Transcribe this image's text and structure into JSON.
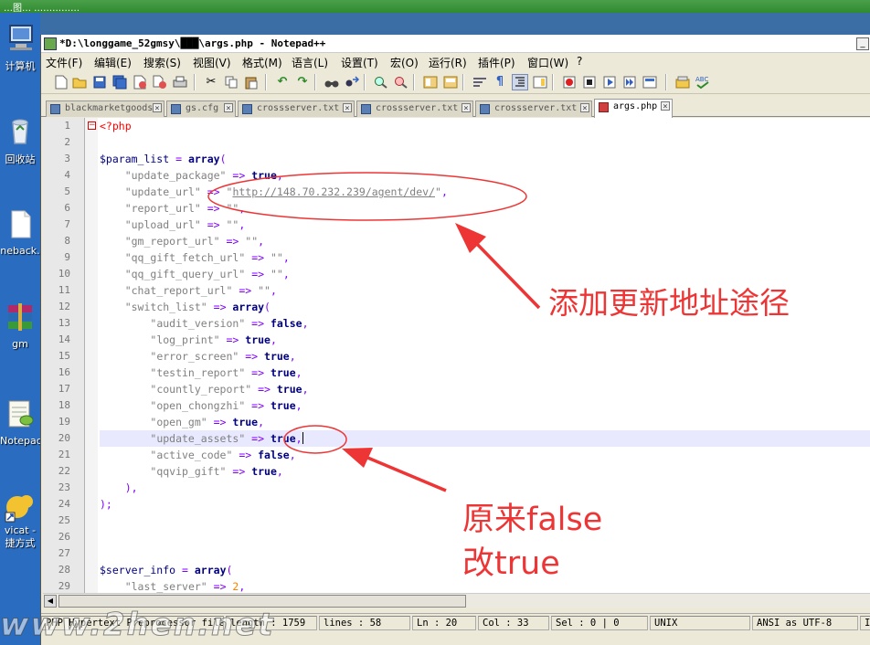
{
  "desktop": {
    "top_text": "…图… ……………",
    "icons": [
      {
        "label": "计算机",
        "icon": "computer-icon"
      },
      {
        "label": "回收站",
        "icon": "recycle-bin-icon"
      },
      {
        "label": "neback.",
        "icon": "document-icon"
      },
      {
        "label": "gm",
        "icon": "winrar-icon"
      },
      {
        "label": "Notepad+",
        "icon": "notepad-plus-icon"
      },
      {
        "label": "vicat -",
        "icon": "navicat-icon"
      },
      {
        "label": "捷方式",
        "icon": "shortcut-icon"
      }
    ]
  },
  "window": {
    "title": "*D:\\longgame_52gmsy\\███\\args.php - Notepad++",
    "minimize": "_"
  },
  "menu": [
    "文件(F)",
    "编辑(E)",
    "搜索(S)",
    "视图(V)",
    "格式(M)",
    "语言(L)",
    "设置(T)",
    "宏(O)",
    "运行(R)",
    "插件(P)",
    "窗口(W)",
    "?"
  ],
  "toolbar": [
    "new-file-icon",
    "open-file-icon",
    "save-icon",
    "save-all-icon",
    "close-icon",
    "close-all-icon",
    "print-icon",
    "cut-icon",
    "copy-icon",
    "paste-icon",
    "undo-icon",
    "redo-icon",
    "find-icon",
    "replace-icon",
    "zoom-in-icon",
    "zoom-out-icon",
    "sync-vertical-icon",
    "sync-horizontal-icon",
    "word-wrap-icon",
    "show-all-chars-icon",
    "indent-guide-icon",
    "document-map-icon",
    "record-macro-icon",
    "stop-record-icon",
    "play-macro-icon",
    "run-macro-multiple-icon",
    "save-macro-icon",
    "doc-switcher-icon",
    "spell-check-icon"
  ],
  "tabs": [
    {
      "label": "blackmarketgoods",
      "active": false
    },
    {
      "label": "gs.cfg",
      "active": false
    },
    {
      "label": "crossserver.txt",
      "active": false
    },
    {
      "label": "crossserver.txt",
      "active": false
    },
    {
      "label": "crossserver.txt",
      "active": false
    },
    {
      "label": "args.php",
      "active": true
    }
  ],
  "editor": {
    "current_line": 20,
    "lines": [
      {
        "n": "1",
        "t": [
          [
            "tag",
            "<?php"
          ]
        ]
      },
      {
        "n": "2",
        "t": []
      },
      {
        "n": "3",
        "t": [
          [
            "var",
            "$param_list"
          ],
          [
            "op",
            " = "
          ],
          [
            "kw",
            "array"
          ],
          [
            "op",
            "("
          ]
        ]
      },
      {
        "n": "4",
        "t": [
          [
            "txt",
            "    "
          ],
          [
            "str",
            "\"update_package\""
          ],
          [
            "op",
            " => "
          ],
          [
            "kw",
            "true"
          ],
          [
            "op",
            ","
          ]
        ]
      },
      {
        "n": "5",
        "t": [
          [
            "txt",
            "    "
          ],
          [
            "str",
            "\"update_url\""
          ],
          [
            "op",
            " => "
          ],
          [
            "str",
            "\""
          ],
          [
            "url",
            "http://148.70.232.239/agent/dev/"
          ],
          [
            "str",
            "\""
          ],
          [
            "op",
            ","
          ]
        ]
      },
      {
        "n": "6",
        "t": [
          [
            "txt",
            "    "
          ],
          [
            "str",
            "\"report_url\""
          ],
          [
            "op",
            " => "
          ],
          [
            "str",
            "\"\""
          ],
          [
            "op",
            ","
          ]
        ]
      },
      {
        "n": "7",
        "t": [
          [
            "txt",
            "    "
          ],
          [
            "str",
            "\"upload_url\""
          ],
          [
            "op",
            " => "
          ],
          [
            "str",
            "\"\""
          ],
          [
            "op",
            ","
          ]
        ]
      },
      {
        "n": "8",
        "t": [
          [
            "txt",
            "    "
          ],
          [
            "str",
            "\"gm_report_url\""
          ],
          [
            "op",
            " => "
          ],
          [
            "str",
            "\"\""
          ],
          [
            "op",
            ","
          ]
        ]
      },
      {
        "n": "9",
        "t": [
          [
            "txt",
            "    "
          ],
          [
            "str",
            "\"qq_gift_fetch_url\""
          ],
          [
            "op",
            " => "
          ],
          [
            "str",
            "\"\""
          ],
          [
            "op",
            ","
          ]
        ]
      },
      {
        "n": "10",
        "t": [
          [
            "txt",
            "    "
          ],
          [
            "str",
            "\"qq_gift_query_url\""
          ],
          [
            "op",
            " => "
          ],
          [
            "str",
            "\"\""
          ],
          [
            "op",
            ","
          ]
        ]
      },
      {
        "n": "11",
        "t": [
          [
            "txt",
            "    "
          ],
          [
            "str",
            "\"chat_report_url\""
          ],
          [
            "op",
            " => "
          ],
          [
            "str",
            "\"\""
          ],
          [
            "op",
            ","
          ]
        ]
      },
      {
        "n": "12",
        "t": [
          [
            "txt",
            "    "
          ],
          [
            "str",
            "\"switch_list\""
          ],
          [
            "op",
            " => "
          ],
          [
            "kw",
            "array"
          ],
          [
            "op",
            "("
          ]
        ]
      },
      {
        "n": "13",
        "t": [
          [
            "txt",
            "        "
          ],
          [
            "str",
            "\"audit_version\""
          ],
          [
            "op",
            " => "
          ],
          [
            "kw",
            "false"
          ],
          [
            "op",
            ","
          ]
        ]
      },
      {
        "n": "14",
        "t": [
          [
            "txt",
            "        "
          ],
          [
            "str",
            "\"log_print\""
          ],
          [
            "op",
            " => "
          ],
          [
            "kw",
            "true"
          ],
          [
            "op",
            ","
          ]
        ]
      },
      {
        "n": "15",
        "t": [
          [
            "txt",
            "        "
          ],
          [
            "str",
            "\"error_screen\""
          ],
          [
            "op",
            " => "
          ],
          [
            "kw",
            "true"
          ],
          [
            "op",
            ","
          ]
        ]
      },
      {
        "n": "16",
        "t": [
          [
            "txt",
            "        "
          ],
          [
            "str",
            "\"testin_report\""
          ],
          [
            "op",
            " => "
          ],
          [
            "kw",
            "true"
          ],
          [
            "op",
            ","
          ]
        ]
      },
      {
        "n": "17",
        "t": [
          [
            "txt",
            "        "
          ],
          [
            "str",
            "\"countly_report\""
          ],
          [
            "op",
            " => "
          ],
          [
            "kw",
            "true"
          ],
          [
            "op",
            ","
          ]
        ]
      },
      {
        "n": "18",
        "t": [
          [
            "txt",
            "        "
          ],
          [
            "str",
            "\"open_chongzhi\""
          ],
          [
            "op",
            " => "
          ],
          [
            "kw",
            "true"
          ],
          [
            "op",
            ","
          ]
        ]
      },
      {
        "n": "19",
        "t": [
          [
            "txt",
            "        "
          ],
          [
            "str",
            "\"open_gm\""
          ],
          [
            "op",
            " => "
          ],
          [
            "kw",
            "true"
          ],
          [
            "op",
            ","
          ]
        ]
      },
      {
        "n": "20",
        "t": [
          [
            "txt",
            "        "
          ],
          [
            "str",
            "\"update_assets\""
          ],
          [
            "op",
            " => "
          ],
          [
            "kw",
            "true"
          ],
          [
            "op",
            ","
          ]
        ]
      },
      {
        "n": "21",
        "t": [
          [
            "txt",
            "        "
          ],
          [
            "str",
            "\"active_code\""
          ],
          [
            "op",
            " => "
          ],
          [
            "kw",
            "false"
          ],
          [
            "op",
            ","
          ]
        ]
      },
      {
        "n": "22",
        "t": [
          [
            "txt",
            "        "
          ],
          [
            "str",
            "\"qqvip_gift\""
          ],
          [
            "op",
            " => "
          ],
          [
            "kw",
            "true"
          ],
          [
            "op",
            ","
          ]
        ]
      },
      {
        "n": "23",
        "t": [
          [
            "txt",
            "    "
          ],
          [
            "op",
            "),"
          ]
        ]
      },
      {
        "n": "24",
        "t": [
          [
            "op",
            ");"
          ]
        ]
      },
      {
        "n": "25",
        "t": []
      },
      {
        "n": "26",
        "t": []
      },
      {
        "n": "27",
        "t": []
      },
      {
        "n": "28",
        "t": [
          [
            "var",
            "$server_info"
          ],
          [
            "op",
            " = "
          ],
          [
            "kw",
            "array"
          ],
          [
            "op",
            "("
          ]
        ]
      },
      {
        "n": "29",
        "t": [
          [
            "txt",
            "    "
          ],
          [
            "str",
            "\"last_server\""
          ],
          [
            "op",
            " => "
          ],
          [
            "num",
            "2"
          ],
          [
            "op",
            ","
          ]
        ]
      }
    ]
  },
  "status": {
    "type": "PHP Hypertext Preprocessor file",
    "length": "length : 1759",
    "lines": "lines : 58",
    "ln": "Ln : 20",
    "col": "Col : 33",
    "sel": "Sel : 0 | 0",
    "eol": "UNIX",
    "encoding": "ANSI as UTF-8",
    "ins": "IN"
  },
  "annotations": {
    "note1": "添加更新地址途径",
    "note2_line1": "原来false",
    "note2_line2": "改true",
    "color": "#ee3535"
  },
  "watermark": "www.2hen.net"
}
